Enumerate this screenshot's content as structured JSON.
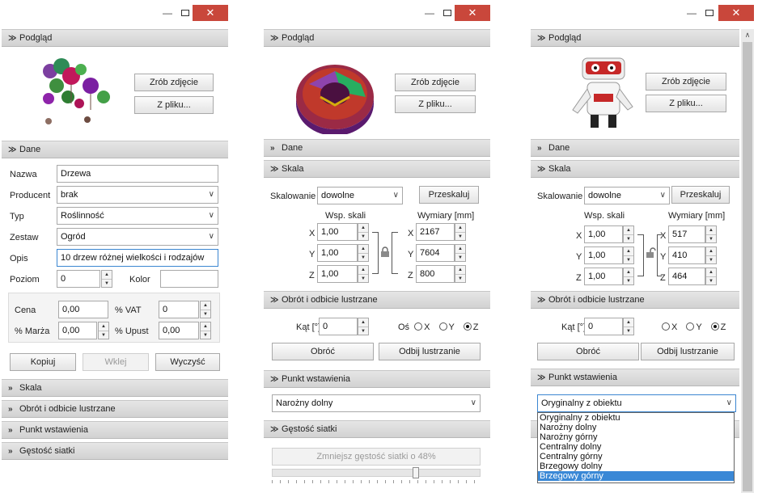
{
  "window": {
    "minimize": "—",
    "close": "✕"
  },
  "sections": {
    "preview": "Podgląd",
    "data": "Dane",
    "scale": "Skala",
    "rotate": "Obrót i odbicie lustrzane",
    "insert_point": "Punkt wstawienia",
    "grid_density": "Gęstość siatki"
  },
  "preview": {
    "take_photo": "Zrób zdjęcie",
    "from_file": "Z pliku..."
  },
  "form": {
    "name_label": "Nazwa",
    "name_value": "Drzewa",
    "producer_label": "Producent",
    "producer_value": "brak",
    "type_label": "Typ",
    "type_value": "Roślinność",
    "set_label": "Zestaw",
    "set_value": "Ogród",
    "desc_label": "Opis",
    "desc_value": "10 drzew różnej wielkości i rodzajów",
    "level_label": "Poziom",
    "level_value": "0",
    "color_label": "Kolor",
    "color_value": "",
    "price_label": "Cena",
    "price_value": "0,00",
    "vat_label": "% VAT",
    "vat_value": "0",
    "margin_label": "% Marża",
    "margin_value": "0,00",
    "discount_label": "% Upust",
    "discount_value": "0,00",
    "copy": "Kopiuj",
    "paste": "Wklej",
    "clear": "Wyczyść"
  },
  "scale_mid": {
    "scaling_label": "Skalowanie",
    "scaling_value": "dowolne",
    "rescale": "Przeskaluj",
    "factor_header": "Wsp. skali",
    "dims_header": "Wymiary [mm]",
    "axes": [
      "X",
      "Y",
      "Z"
    ],
    "factors": [
      "1,00",
      "1,00",
      "1,00"
    ],
    "dims": [
      "2167",
      "7604",
      "800"
    ]
  },
  "scale_right": {
    "scaling_label": "Skalowanie",
    "scaling_value": "dowolne",
    "rescale": "Przeskaluj",
    "factor_header": "Wsp. skali",
    "dims_header": "Wymiary [mm]",
    "axes": [
      "X",
      "Y",
      "Z"
    ],
    "factors": [
      "1,00",
      "1,00",
      "1,00"
    ],
    "dims": [
      "517",
      "410",
      "464"
    ]
  },
  "rotate": {
    "angle_label": "Kąt [°]",
    "angle_mid": "0",
    "angle_right": "0",
    "axis_label": "Oś",
    "x": "X",
    "y": "Y",
    "z": "Z",
    "selected": "Z",
    "rotate_btn": "Obróć",
    "mirror_btn": "Odbij lustrzanie"
  },
  "insert_point": {
    "mid_value": "Narożny dolny",
    "right_value": "Oryginalny z obiektu",
    "options": [
      "Oryginalny z obiektu",
      "Narożny dolny",
      "Narożny górny",
      "Centralny dolny",
      "Centralny górny",
      "Brzegowy dolny",
      "Brzegowy górny"
    ],
    "highlighted": "Brzegowy górny"
  },
  "density": {
    "reduce_btn": "Zmniejsz gęstość siatki o 48%",
    "slider_value": 0.48
  },
  "icons": {
    "expanded": "chevron-down-double-icon",
    "collapsed": "chevron-right-double-icon",
    "lock_closed": "lock-icon",
    "lock_open": "unlock-icon"
  },
  "colors": {
    "close_button": "#c9473b",
    "selection": "#3a88d6",
    "header": "#d9d9d9"
  }
}
